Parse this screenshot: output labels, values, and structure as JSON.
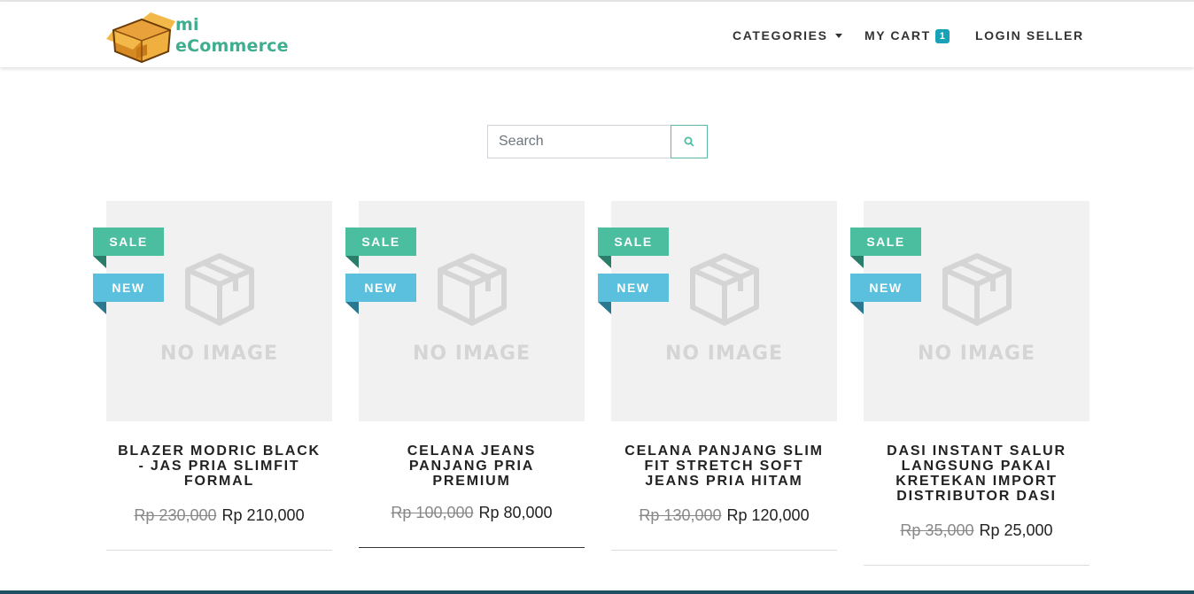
{
  "brand": {
    "line1": "mi",
    "line2": "eCommerce"
  },
  "nav": {
    "categories": "CATEGORIES",
    "cart": "MY CART",
    "cart_count": "1",
    "login": "LOGIN SELLER"
  },
  "search": {
    "placeholder": "Search"
  },
  "products": [
    {
      "title": "BLAZER MODRIC BLACK - JAS PRIA SLIMFIT FORMAL",
      "old_price": "Rp 230,000",
      "price": "Rp 210,000",
      "sale": "SALE",
      "new": "NEW",
      "no_image": "NO IMAGE"
    },
    {
      "title": "CELANA JEANS PANJANG PRIA PREMIUM",
      "old_price": "Rp 100,000",
      "price": "Rp 80,000",
      "sale": "SALE",
      "new": "NEW",
      "no_image": "NO IMAGE"
    },
    {
      "title": "CELANA PANJANG SLIM FIT STRETCH SOFT JEANS PRIA HITAM",
      "old_price": "Rp 130,000",
      "price": "Rp 120,000",
      "sale": "SALE",
      "new": "NEW",
      "no_image": "NO IMAGE"
    },
    {
      "title": "DASI INSTANT SALUR LANGSUNG PAKAI KRETEKAN IMPORT DISTRIBUTOR DASI",
      "old_price": "Rp 35,000",
      "price": "Rp 25,000",
      "sale": "SALE",
      "new": "NEW",
      "no_image": "NO IMAGE"
    }
  ],
  "colors": {
    "accent": "#4cbea0",
    "new_badge": "#5bc0de",
    "cart_badge": "#17a2b8",
    "brand_text": "#3fae8f"
  }
}
